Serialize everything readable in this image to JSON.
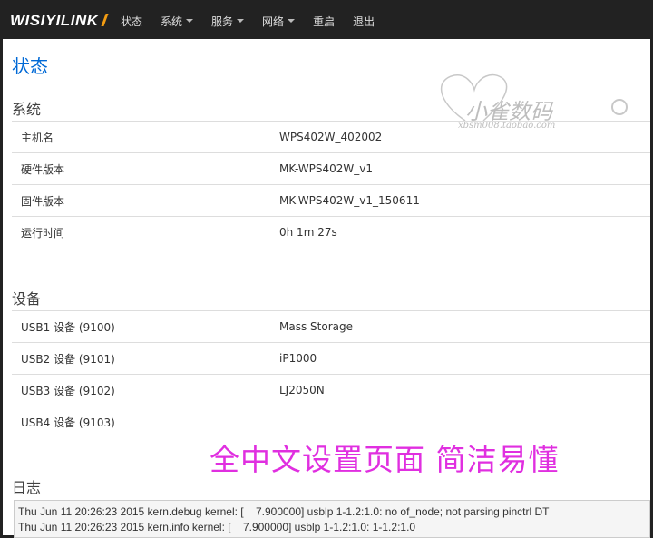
{
  "navbar": {
    "brand": "WISIYILINK",
    "items": [
      {
        "label": "状态",
        "dropdown": false
      },
      {
        "label": "系统",
        "dropdown": true
      },
      {
        "label": "服务",
        "dropdown": true
      },
      {
        "label": "网络",
        "dropdown": true
      },
      {
        "label": "重启",
        "dropdown": false
      },
      {
        "label": "退出",
        "dropdown": false
      }
    ]
  },
  "page": {
    "title": "状态"
  },
  "system": {
    "title": "系统",
    "rows": [
      {
        "key": "主机名",
        "value": "WPS402W_402002"
      },
      {
        "key": "硬件版本",
        "value": "MK-WPS402W_v1"
      },
      {
        "key": "固件版本",
        "value": "MK-WPS402W_v1_150611"
      },
      {
        "key": "运行时间",
        "value": "0h 1m 27s"
      }
    ]
  },
  "devices": {
    "title": "设备",
    "rows": [
      {
        "key": "USB1 设备 (9100)",
        "value": "Mass Storage"
      },
      {
        "key": "USB2 设备 (9101)",
        "value": "iP1000"
      },
      {
        "key": "USB3 设备 (9102)",
        "value": "LJ2050N"
      },
      {
        "key": "USB4 设备 (9103)",
        "value": ""
      }
    ]
  },
  "banner": "全中文设置页面 简洁易懂",
  "watermark": {
    "text": "小雀数码",
    "sub": "xbsm008.taobao.com"
  },
  "log": {
    "title": "日志",
    "lines": [
      "Thu Jun 11 20:26:23 2015 kern.debug kernel: [    7.900000] usblp 1-1.2:1.0: no of_node; not parsing pinctrl DT",
      "Thu Jun 11 20:26:23 2015 kern.info kernel: [    7.900000] usblp 1-1.2:1.0: 1-1.2:1.0"
    ]
  },
  "colors": {
    "navbar": "#222222",
    "title_blue": "#0069d6",
    "banner_magenta": "#e02fe0",
    "brand_accent": "#f39c12"
  }
}
